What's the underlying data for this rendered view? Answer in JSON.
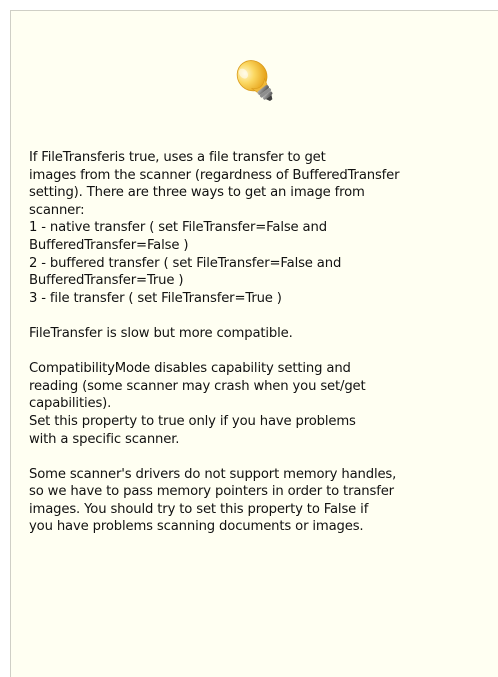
{
  "panel": {
    "icon": "lightbulb-icon",
    "paragraphs": [
      {
        "lines": [
          "If FileTransferis true, uses a file transfer to get",
          "images from the scanner (regardness of BufferedTransfer",
          "setting). There are three ways to get an image from",
          "scanner:",
          "1 - native transfer ( set FileTransfer=False and",
          "BufferedTransfer=False )",
          "2 - buffered transfer ( set FileTransfer=False and",
          "BufferedTransfer=True )",
          "3 - file transfer ( set FileTransfer=True )"
        ]
      },
      {
        "lines": [
          "FileTransfer is slow but more compatible."
        ]
      },
      {
        "lines": [
          "CompatibilityMode disables capability setting and",
          "reading (some scanner may crash when you set/get",
          "capabilities).",
          "Set this property to true only if you have problems",
          "with a specific scanner."
        ]
      },
      {
        "lines": [
          "Some scanner's drivers do not support memory handles,",
          "so we have to pass memory pointers in order to transfer",
          "images. You should try to set this property to False if",
          "you have problems scanning documents or images."
        ]
      }
    ]
  },
  "colors": {
    "panel_background": "#fffff2",
    "text": "#111111",
    "bulb_glass": "#f7c63a",
    "bulb_base": "#5a5a5a"
  }
}
